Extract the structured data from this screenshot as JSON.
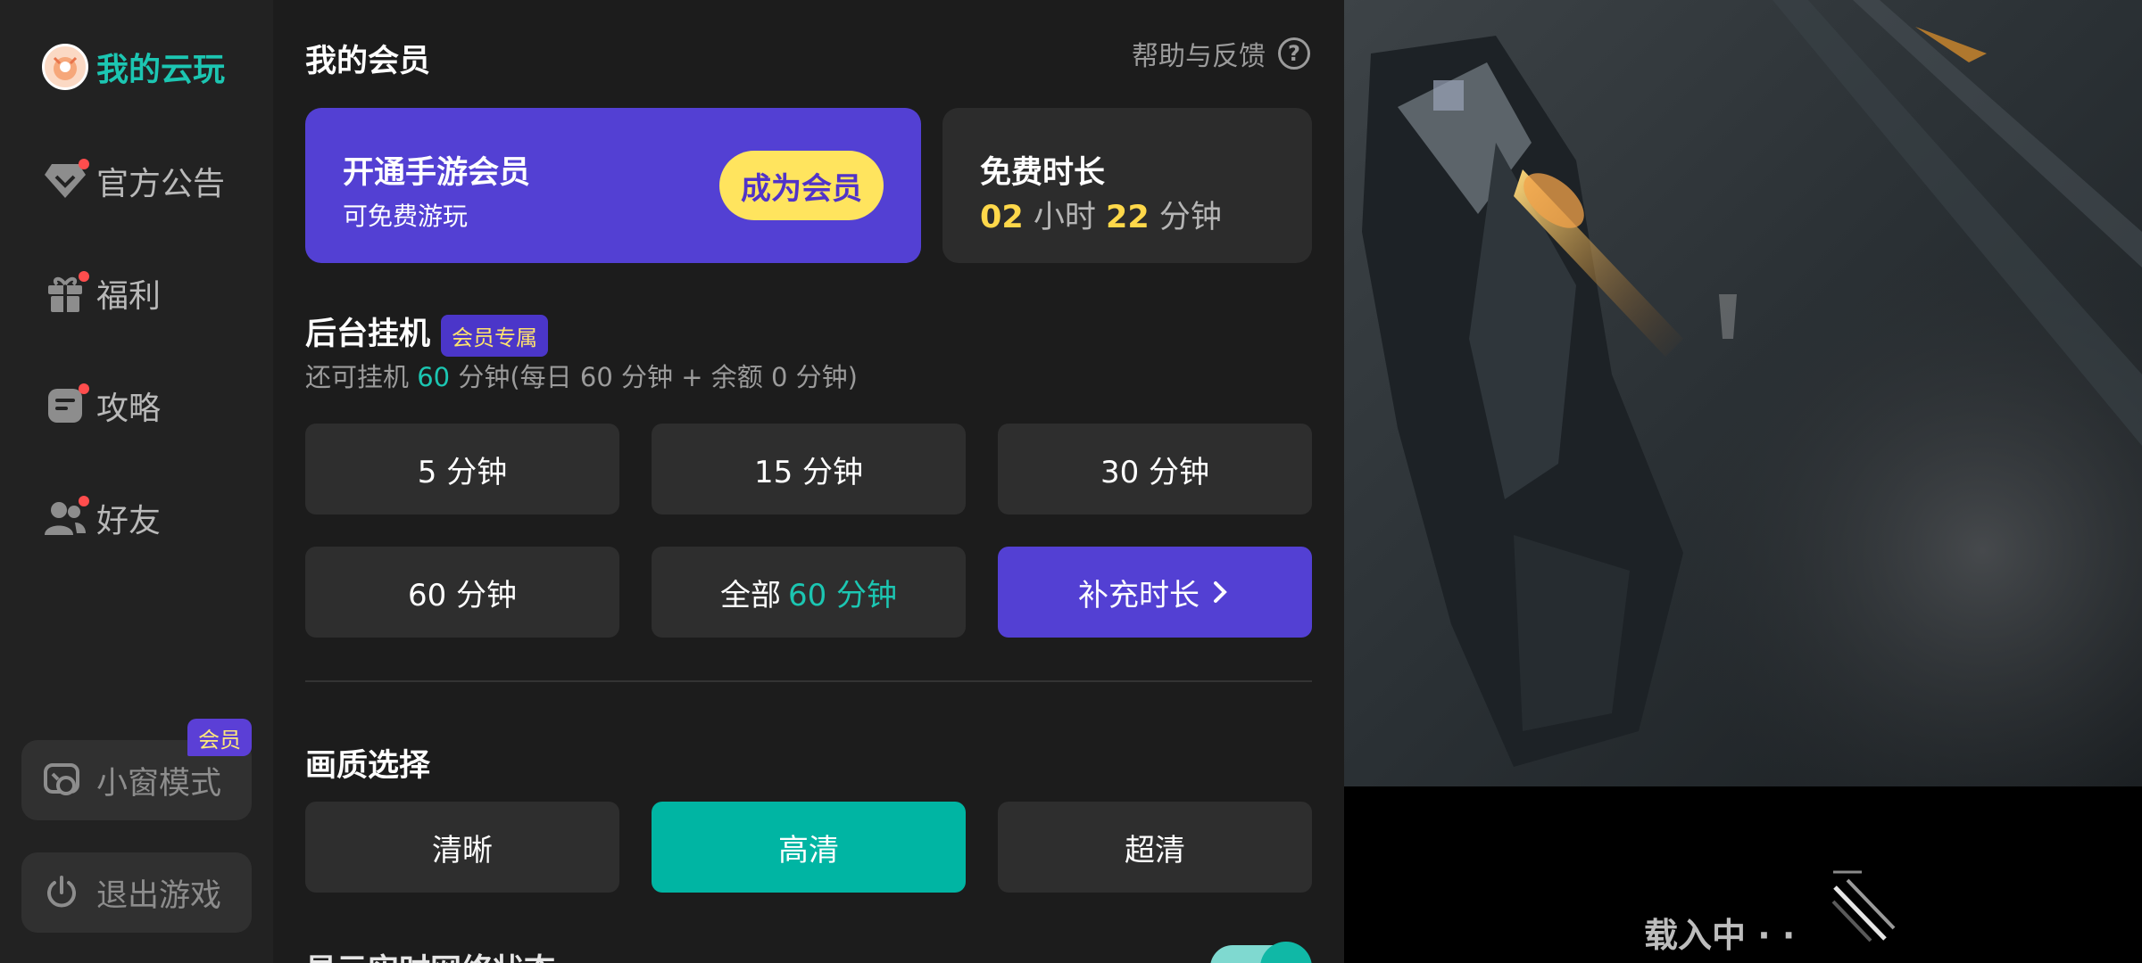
{
  "sidebar": {
    "items": [
      {
        "label": "我的云玩",
        "icon": "avatar-icon",
        "active": true,
        "dot": false
      },
      {
        "label": "官方公告",
        "icon": "diamond-icon",
        "active": false,
        "dot": true
      },
      {
        "label": "福利",
        "icon": "gift-icon",
        "active": false,
        "dot": true
      },
      {
        "label": "攻略",
        "icon": "note-icon",
        "active": false,
        "dot": true
      },
      {
        "label": "好友",
        "icon": "friends-icon",
        "active": false,
        "dot": true
      }
    ],
    "mini_window": {
      "label": "小窗模式",
      "badge": "会员",
      "icon": "mini-window-icon"
    },
    "exit_game": {
      "label": "退出游戏",
      "icon": "power-icon"
    }
  },
  "header": {
    "title": "我的会员",
    "help": "帮助与反馈",
    "help_icon": "question-icon"
  },
  "vip_card": {
    "title": "开通手游会员",
    "subtitle": "可免费游玩",
    "button": "成为会员"
  },
  "free_time": {
    "title": "免费时长",
    "hours": "02",
    "hours_unit": "小时",
    "minutes": "22",
    "minutes_unit": "分钟"
  },
  "idle": {
    "title": "后台挂机",
    "badge": "会员专属",
    "remaining_prefix": "还可挂机",
    "remaining_value": "60",
    "remaining_suffix": "分钟(每日 60 分钟 + 余额 0 分钟)",
    "options": [
      "5 分钟",
      "15 分钟",
      "30 分钟",
      "60 分钟"
    ],
    "all_label": "全部",
    "all_value": "60 分钟",
    "recharge": "补充时长"
  },
  "quality": {
    "title": "画质选择",
    "options": [
      "清晰",
      "高清",
      "超清"
    ],
    "selected": "高清"
  },
  "network": {
    "title": "显示实时网络状态",
    "enabled": true
  },
  "game": {
    "loading": "载入中 · ·"
  },
  "colors": {
    "accent_teal": "#1cc6b2",
    "purple": "#5340d3",
    "yellow": "#ffe45e",
    "panel_bg": "#1c1c1c",
    "sidebar_bg": "#222222"
  }
}
